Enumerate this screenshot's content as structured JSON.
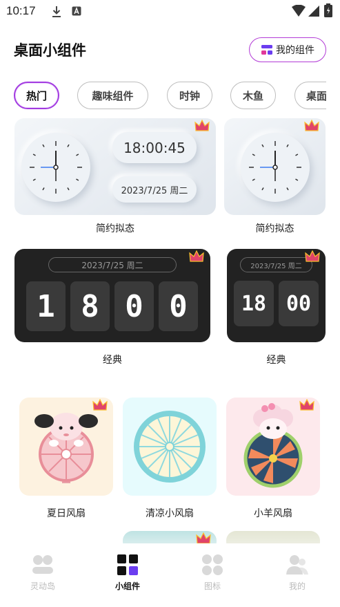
{
  "status_bar": {
    "time": "10:17"
  },
  "header": {
    "title": "桌面小组件",
    "my_widgets_label": "我的组件"
  },
  "categories": [
    {
      "label": "热门",
      "active": true
    },
    {
      "label": "趣味组件",
      "active": false
    },
    {
      "label": "时钟",
      "active": false
    },
    {
      "label": "木鱼",
      "active": false
    },
    {
      "label": "桌面",
      "active": false
    }
  ],
  "widgets": {
    "neumorphic_large": {
      "time": "18:00:45",
      "date": "2023/7/25 周二",
      "caption": "简约拟态"
    },
    "neumorphic_small": {
      "caption": "简约拟态"
    },
    "classic_large": {
      "date": "2023/7/25 周二",
      "digits": [
        "1",
        "8",
        "0",
        "0"
      ],
      "caption": "经典"
    },
    "classic_small": {
      "date": "2023/7/25 周二",
      "digits": [
        "18",
        "00"
      ],
      "caption": "经典"
    },
    "fans": [
      {
        "caption": "夏日风扇"
      },
      {
        "caption": "清凉小风扇"
      },
      {
        "caption": "小羊风扇"
      }
    ]
  },
  "bottom_nav": [
    {
      "label": "灵动岛",
      "icon": "island-icon",
      "active": false
    },
    {
      "label": "小组件",
      "icon": "widget-grid-icon",
      "active": true
    },
    {
      "label": "图标",
      "icon": "icons-grid-icon",
      "active": false
    },
    {
      "label": "我的",
      "icon": "profile-icon",
      "active": false
    }
  ],
  "colors": {
    "accent": "#a23be0",
    "crown": "#e0446a"
  }
}
